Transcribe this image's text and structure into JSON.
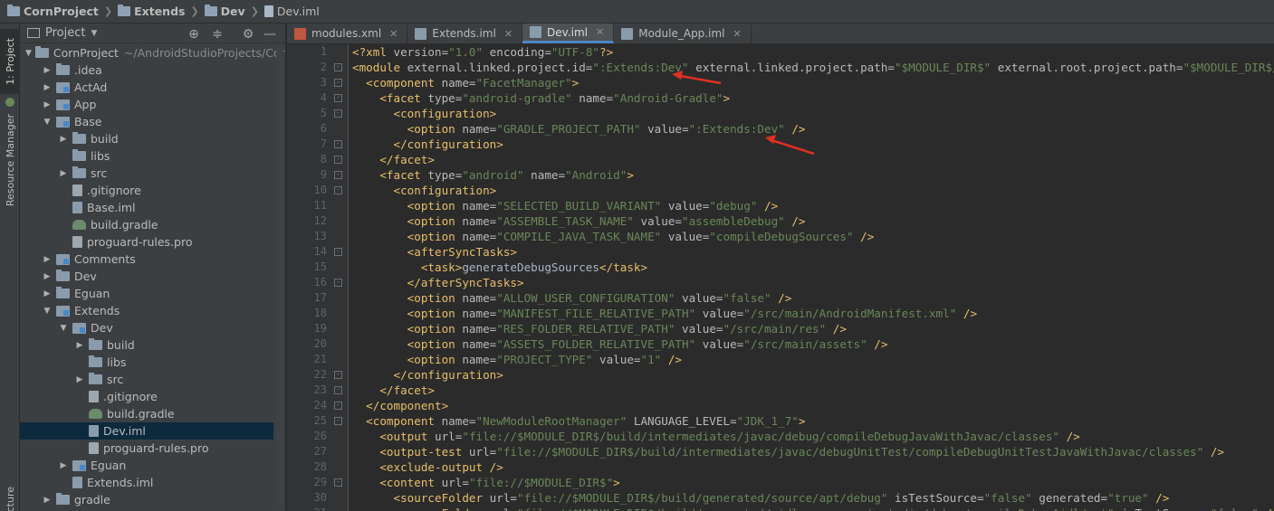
{
  "breadcrumb": [
    "CornProject",
    "Extends",
    "Dev",
    "Dev.iml"
  ],
  "toolstrip": {
    "project_tab": "1: Project",
    "resource_tab": "Resource Manager",
    "structure_tab": "ucture"
  },
  "project_panel": {
    "title": "Project",
    "tree": [
      {
        "label": "CornProject",
        "hint": "~/AndroidStudioProjects/Cor",
        "icon": "folder",
        "arrow": "down",
        "depth": 0
      },
      {
        "label": ".idea",
        "icon": "folder",
        "arrow": "right",
        "depth": 1
      },
      {
        "label": "ActAd",
        "icon": "module",
        "arrow": "right",
        "depth": 1
      },
      {
        "label": "App",
        "icon": "module",
        "arrow": "right",
        "depth": 1
      },
      {
        "label": "Base",
        "icon": "module",
        "arrow": "down",
        "depth": 1
      },
      {
        "label": "build",
        "icon": "folder",
        "arrow": "right",
        "depth": 2
      },
      {
        "label": "libs",
        "icon": "folder",
        "arrow": "",
        "depth": 2
      },
      {
        "label": "src",
        "icon": "folder",
        "arrow": "right",
        "depth": 2
      },
      {
        "label": ".gitignore",
        "icon": "file",
        "arrow": "",
        "depth": 2
      },
      {
        "label": "Base.iml",
        "icon": "iml",
        "arrow": "",
        "depth": 2
      },
      {
        "label": "build.gradle",
        "icon": "gradle",
        "arrow": "",
        "depth": 2
      },
      {
        "label": "proguard-rules.pro",
        "icon": "file",
        "arrow": "",
        "depth": 2
      },
      {
        "label": "Comments",
        "icon": "module",
        "arrow": "right",
        "depth": 1
      },
      {
        "label": "Dev",
        "icon": "folder",
        "arrow": "right",
        "depth": 1
      },
      {
        "label": "Eguan",
        "icon": "folder",
        "arrow": "right",
        "depth": 1
      },
      {
        "label": "Extends",
        "icon": "module",
        "arrow": "down",
        "depth": 1
      },
      {
        "label": "Dev",
        "icon": "module",
        "arrow": "down",
        "depth": 2
      },
      {
        "label": "build",
        "icon": "folder",
        "arrow": "right",
        "depth": 3
      },
      {
        "label": "libs",
        "icon": "folder",
        "arrow": "",
        "depth": 3
      },
      {
        "label": "src",
        "icon": "folder",
        "arrow": "right",
        "depth": 3
      },
      {
        "label": ".gitignore",
        "icon": "file",
        "arrow": "",
        "depth": 3
      },
      {
        "label": "build.gradle",
        "icon": "gradle",
        "arrow": "",
        "depth": 3
      },
      {
        "label": "Dev.iml",
        "icon": "iml",
        "arrow": "",
        "depth": 3,
        "selected": true
      },
      {
        "label": "proguard-rules.pro",
        "icon": "file",
        "arrow": "",
        "depth": 3
      },
      {
        "label": "Eguan",
        "icon": "module",
        "arrow": "right",
        "depth": 2
      },
      {
        "label": "Extends.iml",
        "icon": "iml",
        "arrow": "",
        "depth": 2
      },
      {
        "label": "gradle",
        "icon": "folder",
        "arrow": "right",
        "depth": 1
      }
    ]
  },
  "tabs": [
    {
      "label": "modules.xml",
      "color": "#c0573f"
    },
    {
      "label": "Extends.iml",
      "color": "#8a9bab"
    },
    {
      "label": "Dev.iml",
      "color": "#8a9bab",
      "active": true
    },
    {
      "label": "Module_App.iml",
      "color": "#8a9bab"
    }
  ],
  "editor": {
    "lines": [
      [
        [
          "t",
          "<?xml "
        ],
        [
          "a",
          "version="
        ],
        [
          "v",
          "\"1.0\""
        ],
        [
          "a",
          " encoding="
        ],
        [
          "v",
          "\"UTF-8\""
        ],
        [
          "t",
          "?>"
        ]
      ],
      [
        [
          "t",
          "<module "
        ],
        [
          "a",
          "external.linked.project.id="
        ],
        [
          "v",
          "\":Extends:Dev\""
        ],
        [
          "a",
          " external.linked.project.path="
        ],
        [
          "v",
          "\"$MODULE_DIR$\""
        ],
        [
          "a",
          " external.root.project.path="
        ],
        [
          "v",
          "\"$MODULE_DIR$/../..\""
        ]
      ],
      [
        [
          "x",
          "  "
        ],
        [
          "t",
          "<component "
        ],
        [
          "a",
          "name="
        ],
        [
          "v",
          "\"FacetManager\""
        ],
        [
          "t",
          ">"
        ]
      ],
      [
        [
          "x",
          "    "
        ],
        [
          "t",
          "<facet "
        ],
        [
          "a",
          "type="
        ],
        [
          "v",
          "\"android-gradle\""
        ],
        [
          "a",
          " name="
        ],
        [
          "v",
          "\"Android-Gradle\""
        ],
        [
          "t",
          ">"
        ]
      ],
      [
        [
          "x",
          "      "
        ],
        [
          "t",
          "<configuration>"
        ]
      ],
      [
        [
          "x",
          "        "
        ],
        [
          "t",
          "<option "
        ],
        [
          "a",
          "name="
        ],
        [
          "v",
          "\"GRADLE_PROJECT_PATH\""
        ],
        [
          "a",
          " value="
        ],
        [
          "v",
          "\":Extends:Dev\""
        ],
        [
          "t",
          " />"
        ]
      ],
      [
        [
          "x",
          "      "
        ],
        [
          "t",
          "</configuration>"
        ]
      ],
      [
        [
          "x",
          "    "
        ],
        [
          "t",
          "</facet>"
        ]
      ],
      [
        [
          "x",
          "    "
        ],
        [
          "t",
          "<facet "
        ],
        [
          "a",
          "type="
        ],
        [
          "v",
          "\"android\""
        ],
        [
          "a",
          " name="
        ],
        [
          "v",
          "\"Android\""
        ],
        [
          "t",
          ">"
        ]
      ],
      [
        [
          "x",
          "      "
        ],
        [
          "t",
          "<configuration>"
        ]
      ],
      [
        [
          "x",
          "        "
        ],
        [
          "t",
          "<option "
        ],
        [
          "a",
          "name="
        ],
        [
          "v",
          "\"SELECTED_BUILD_VARIANT\""
        ],
        [
          "a",
          " value="
        ],
        [
          "v",
          "\"debug\""
        ],
        [
          "t",
          " />"
        ]
      ],
      [
        [
          "x",
          "        "
        ],
        [
          "t",
          "<option "
        ],
        [
          "a",
          "name="
        ],
        [
          "v",
          "\"ASSEMBLE_TASK_NAME\""
        ],
        [
          "a",
          " value="
        ],
        [
          "v",
          "\"assembleDebug\""
        ],
        [
          "t",
          " />"
        ]
      ],
      [
        [
          "x",
          "        "
        ],
        [
          "t",
          "<option "
        ],
        [
          "a",
          "name="
        ],
        [
          "v",
          "\"COMPILE_JAVA_TASK_NAME\""
        ],
        [
          "a",
          " value="
        ],
        [
          "v",
          "\"compileDebugSources\""
        ],
        [
          "t",
          " />"
        ]
      ],
      [
        [
          "x",
          "        "
        ],
        [
          "t",
          "<afterSyncTasks>"
        ]
      ],
      [
        [
          "x",
          "          "
        ],
        [
          "t",
          "<task>"
        ],
        [
          "x",
          "generateDebugSources"
        ],
        [
          "t",
          "</task>"
        ]
      ],
      [
        [
          "x",
          "        "
        ],
        [
          "t",
          "</afterSyncTasks>"
        ]
      ],
      [
        [
          "x",
          "        "
        ],
        [
          "t",
          "<option "
        ],
        [
          "a",
          "name="
        ],
        [
          "v",
          "\"ALLOW_USER_CONFIGURATION\""
        ],
        [
          "a",
          " value="
        ],
        [
          "v",
          "\"false\""
        ],
        [
          "t",
          " />"
        ]
      ],
      [
        [
          "x",
          "        "
        ],
        [
          "t",
          "<option "
        ],
        [
          "a",
          "name="
        ],
        [
          "v",
          "\"MANIFEST_FILE_RELATIVE_PATH\""
        ],
        [
          "a",
          " value="
        ],
        [
          "v",
          "\"/src/main/AndroidManifest.xml\""
        ],
        [
          "t",
          " />"
        ]
      ],
      [
        [
          "x",
          "        "
        ],
        [
          "t",
          "<option "
        ],
        [
          "a",
          "name="
        ],
        [
          "v",
          "\"RES_FOLDER_RELATIVE_PATH\""
        ],
        [
          "a",
          " value="
        ],
        [
          "v",
          "\"/src/main/res\""
        ],
        [
          "t",
          " />"
        ]
      ],
      [
        [
          "x",
          "        "
        ],
        [
          "t",
          "<option "
        ],
        [
          "a",
          "name="
        ],
        [
          "v",
          "\"ASSETS_FOLDER_RELATIVE_PATH\""
        ],
        [
          "a",
          " value="
        ],
        [
          "v",
          "\"/src/main/assets\""
        ],
        [
          "t",
          " />"
        ]
      ],
      [
        [
          "x",
          "        "
        ],
        [
          "t",
          "<option "
        ],
        [
          "a",
          "name="
        ],
        [
          "v",
          "\"PROJECT_TYPE\""
        ],
        [
          "a",
          " value="
        ],
        [
          "v",
          "\"1\""
        ],
        [
          "t",
          " />"
        ]
      ],
      [
        [
          "x",
          "      "
        ],
        [
          "t",
          "</configuration>"
        ]
      ],
      [
        [
          "x",
          "    "
        ],
        [
          "t",
          "</facet>"
        ]
      ],
      [
        [
          "x",
          "  "
        ],
        [
          "t",
          "</component>"
        ]
      ],
      [
        [
          "x",
          "  "
        ],
        [
          "t",
          "<component "
        ],
        [
          "a",
          "name="
        ],
        [
          "v",
          "\"NewModuleRootManager\""
        ],
        [
          "a",
          " LANGUAGE_LEVEL="
        ],
        [
          "v",
          "\"JDK_1_7\""
        ],
        [
          "t",
          ">"
        ]
      ],
      [
        [
          "x",
          "    "
        ],
        [
          "t",
          "<output "
        ],
        [
          "a",
          "url="
        ],
        [
          "v",
          "\"file://$MODULE_DIR$/build/intermediates/javac/debug/compileDebugJavaWithJavac/classes\""
        ],
        [
          "t",
          " />"
        ]
      ],
      [
        [
          "x",
          "    "
        ],
        [
          "t",
          "<output-test "
        ],
        [
          "a",
          "url="
        ],
        [
          "v",
          "\"file://$MODULE_DIR$/build/intermediates/javac/debugUnitTest/compileDebugUnitTestJavaWithJavac/classes\""
        ],
        [
          "t",
          " />"
        ]
      ],
      [
        [
          "x",
          "    "
        ],
        [
          "t",
          "<exclude-output />"
        ]
      ],
      [
        [
          "x",
          "    "
        ],
        [
          "t",
          "<content "
        ],
        [
          "a",
          "url="
        ],
        [
          "v",
          "\"file://$MODULE_DIR$\""
        ],
        [
          "t",
          ">"
        ]
      ],
      [
        [
          "x",
          "      "
        ],
        [
          "t",
          "<sourceFolder "
        ],
        [
          "a",
          "url="
        ],
        [
          "v",
          "\"file://$MODULE_DIR$/build/generated/source/apt/debug\""
        ],
        [
          "a",
          " isTestSource="
        ],
        [
          "v",
          "\"false\""
        ],
        [
          "a",
          " generated="
        ],
        [
          "v",
          "\"true\""
        ],
        [
          "t",
          " />"
        ]
      ],
      [
        [
          "x",
          "      "
        ],
        [
          "t",
          "<sourceFolder "
        ],
        [
          "a",
          "url="
        ],
        [
          "v",
          "\"file://$MODULE_DIR$/build/generated/aidl_source_output_dir/debug/compileDebugAidl/out\""
        ],
        [
          "a",
          " isTestSource="
        ],
        [
          "v",
          "\"false\""
        ],
        [
          "t",
          " />"
        ]
      ]
    ]
  }
}
